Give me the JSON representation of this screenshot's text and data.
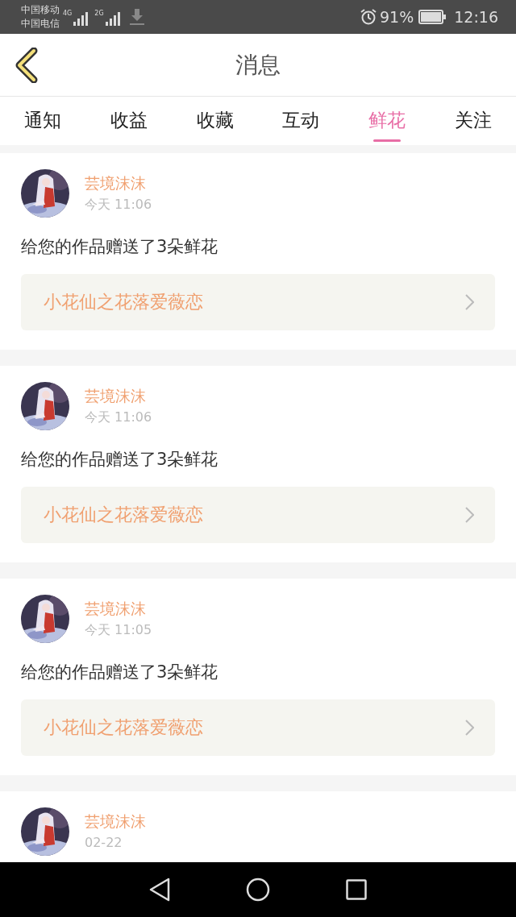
{
  "status_bar": {
    "carriers": [
      "中国移动",
      "中国电信"
    ],
    "network_labels": [
      "4G",
      "2G"
    ],
    "battery_percent": "91%",
    "time": "12:16"
  },
  "header": {
    "title": "消息"
  },
  "tabs": [
    {
      "label": "通知",
      "selected": false
    },
    {
      "label": "收益",
      "selected": false
    },
    {
      "label": "收藏",
      "selected": false
    },
    {
      "label": "互动",
      "selected": false
    },
    {
      "label": "鲜花",
      "selected": true
    },
    {
      "label": "关注",
      "selected": false
    }
  ],
  "messages": [
    {
      "name": "芸境沫沫",
      "time": "今天 11:06",
      "text": "给您的作品赠送了3朵鲜花",
      "work": "小花仙之花落爱薇恋"
    },
    {
      "name": "芸境沫沫",
      "time": "今天 11:06",
      "text": "给您的作品赠送了3朵鲜花",
      "work": "小花仙之花落爱薇恋"
    },
    {
      "name": "芸境沫沫",
      "time": "今天 11:05",
      "text": "给您的作品赠送了3朵鲜花",
      "work": "小花仙之花落爱薇恋"
    },
    {
      "name": "芸境沫沫",
      "time": "02-22"
    }
  ]
}
